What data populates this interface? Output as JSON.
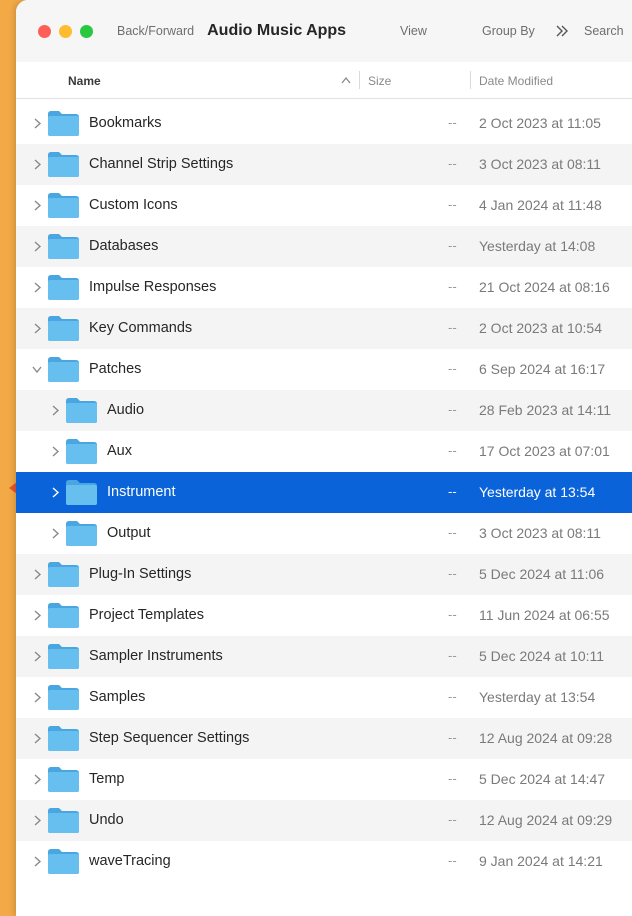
{
  "colors": {
    "desktop": "#F2A946",
    "selection": "#0A63D8",
    "folder": "#67BFF0"
  },
  "window": {
    "nav_label": "Back/Forward",
    "title": "Audio Music Apps",
    "view_label": "View",
    "group_label": "Group By",
    "more_icon": "chevrons-right-icon",
    "search_label": "Search"
  },
  "columns": {
    "name": "Name",
    "size": "Size",
    "date": "Date Modified",
    "sort_icon": "chevron-up-icon"
  },
  "rows": [
    {
      "name": "Bookmarks",
      "size": "--",
      "date": "2 Oct 2023 at 11:05",
      "indent": 0,
      "expanded": false
    },
    {
      "name": "Channel Strip Settings",
      "size": "--",
      "date": "3 Oct 2023 at 08:11",
      "indent": 0,
      "expanded": false
    },
    {
      "name": "Custom Icons",
      "size": "--",
      "date": "4 Jan 2024 at 11:48",
      "indent": 0,
      "expanded": false
    },
    {
      "name": "Databases",
      "size": "--",
      "date": "Yesterday at 14:08",
      "indent": 0,
      "expanded": false
    },
    {
      "name": "Impulse Responses",
      "size": "--",
      "date": "21 Oct 2024 at 08:16",
      "indent": 0,
      "expanded": false
    },
    {
      "name": "Key Commands",
      "size": "--",
      "date": "2 Oct 2023 at 10:54",
      "indent": 0,
      "expanded": false
    },
    {
      "name": "Patches",
      "size": "--",
      "date": "6 Sep 2024 at 16:17",
      "indent": 0,
      "expanded": true
    },
    {
      "name": "Audio",
      "size": "--",
      "date": "28 Feb 2023 at 14:11",
      "indent": 1,
      "expanded": false
    },
    {
      "name": "Aux",
      "size": "--",
      "date": "17 Oct 2023 at 07:01",
      "indent": 1,
      "expanded": false
    },
    {
      "name": "Instrument",
      "size": "--",
      "date": "Yesterday at 13:54",
      "indent": 1,
      "expanded": false,
      "selected": true
    },
    {
      "name": "Output",
      "size": "--",
      "date": "3 Oct 2023 at 08:11",
      "indent": 1,
      "expanded": false
    },
    {
      "name": "Plug-In Settings",
      "size": "--",
      "date": "5 Dec 2024 at 11:06",
      "indent": 0,
      "expanded": false
    },
    {
      "name": "Project Templates",
      "size": "--",
      "date": "11 Jun 2024 at 06:55",
      "indent": 0,
      "expanded": false
    },
    {
      "name": "Sampler Instruments",
      "size": "--",
      "date": "5 Dec 2024 at 10:11",
      "indent": 0,
      "expanded": false
    },
    {
      "name": "Samples",
      "size": "--",
      "date": "Yesterday at 13:54",
      "indent": 0,
      "expanded": false
    },
    {
      "name": "Step Sequencer Settings",
      "size": "--",
      "date": "12 Aug 2024 at 09:28",
      "indent": 0,
      "expanded": false
    },
    {
      "name": "Temp",
      "size": "--",
      "date": "5 Dec 2024 at 14:47",
      "indent": 0,
      "expanded": false
    },
    {
      "name": "Undo",
      "size": "--",
      "date": "12 Aug 2024 at 09:29",
      "indent": 0,
      "expanded": false
    },
    {
      "name": "waveTracing",
      "size": "--",
      "date": "9 Jan 2024 at 14:21",
      "indent": 0,
      "expanded": false
    }
  ]
}
